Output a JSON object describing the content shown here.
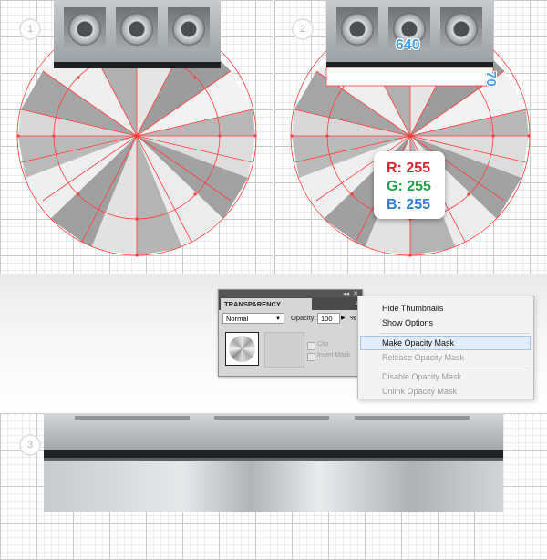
{
  "steps": {
    "one": "1",
    "two": "2",
    "three": "3"
  },
  "dimensions": {
    "width": "640",
    "height": "70"
  },
  "color_readout": {
    "r": "R: 255",
    "g": "G: 255",
    "b": "B: 255"
  },
  "transparency_panel": {
    "title": "TRANSPARENCY",
    "collapse_glyph": "◂◂",
    "close_glyph": "✕",
    "menu_glyph": "≡",
    "blend_mode": "Normal",
    "opacity_label": "Opacity:",
    "opacity_value": "100",
    "opacity_unit": "%",
    "clip_label": "Clip",
    "invert_mask_label": "Invert Mask"
  },
  "panel_menu": {
    "items": [
      {
        "label": "Hide Thumbnails",
        "enabled": true
      },
      {
        "label": "Show Options",
        "enabled": true
      },
      {
        "label": "Make Opacity Mask",
        "enabled": true,
        "highlighted": true
      },
      {
        "label": "Release Opacity Mask",
        "enabled": false
      },
      {
        "label": "Disable Opacity Mask",
        "enabled": false
      },
      {
        "label": "Unlink Opacity Mask",
        "enabled": false
      }
    ]
  },
  "colors": {
    "guide": "#ff3b3b",
    "red": "#e0202a",
    "green": "#22a34a",
    "blue": "#2f7fd0",
    "dimension": "#4aa0e8"
  }
}
